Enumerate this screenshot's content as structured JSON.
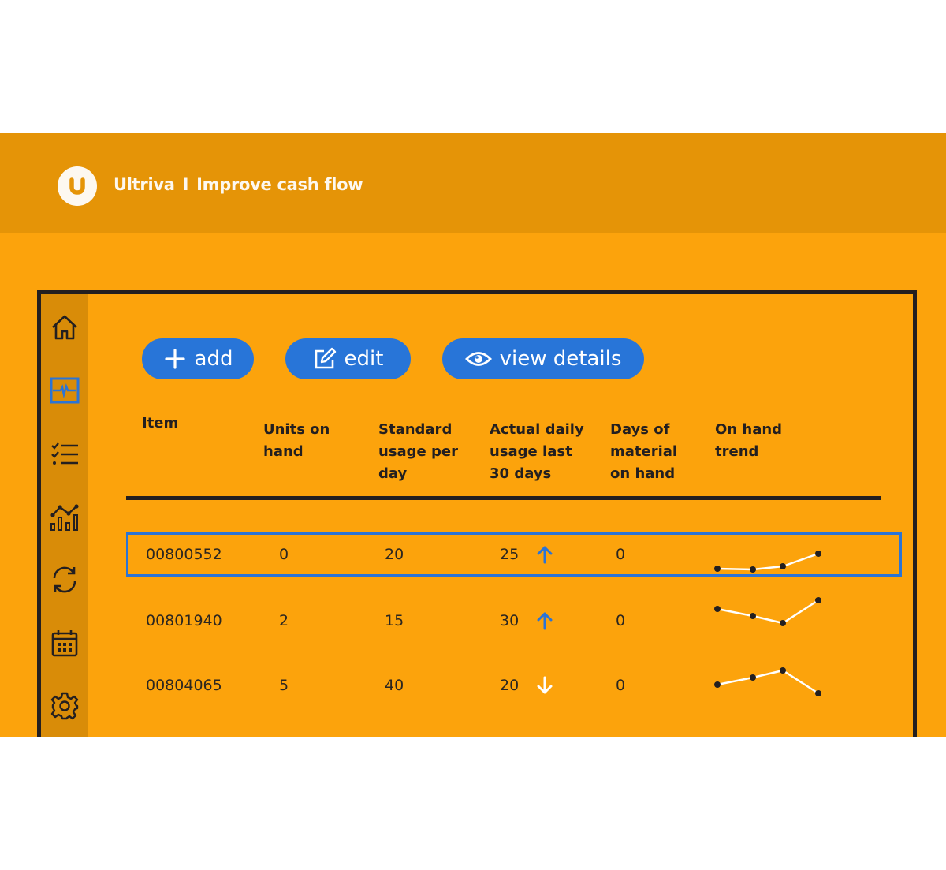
{
  "header": {
    "logo_letter": "U",
    "brand": "Ultriva",
    "separator": "I",
    "tagline": "Improve cash flow"
  },
  "sidebar": {
    "items": [
      {
        "name": "home",
        "icon": "home-icon",
        "active": false
      },
      {
        "name": "monitor",
        "icon": "pulse-monitor-icon",
        "active": true
      },
      {
        "name": "checklist",
        "icon": "checklist-icon",
        "active": false
      },
      {
        "name": "analytics",
        "icon": "analytics-chart-icon",
        "active": false
      },
      {
        "name": "refresh",
        "icon": "refresh-icon",
        "active": false
      },
      {
        "name": "calendar",
        "icon": "calendar-icon",
        "active": false
      },
      {
        "name": "settings",
        "icon": "gear-icon",
        "active": false
      }
    ]
  },
  "toolbar": {
    "add_label": "add",
    "edit_label": "edit",
    "view_label": "view details"
  },
  "table": {
    "columns": [
      "Item",
      "Units on hand",
      "Standard usage per day",
      "Actual daily usage last 30 days",
      "Days of material on hand",
      "On hand trend"
    ],
    "column_lines": [
      [
        "Item"
      ],
      [
        "Units on",
        "hand"
      ],
      [
        "Standard",
        "usage per",
        "day"
      ],
      [
        "Actual daily",
        "usage last",
        "30 days"
      ],
      [
        "Days of",
        "material",
        "on hand"
      ],
      [
        "On hand",
        "trend"
      ]
    ],
    "rows": [
      {
        "item": "00800552",
        "units_on_hand": "0",
        "standard_usage": "20",
        "actual_usage": "25",
        "direction": "up",
        "days_on_hand": "0",
        "trend": [
          1,
          0,
          4,
          20
        ],
        "selected": true
      },
      {
        "item": "00801940",
        "units_on_hand": "2",
        "standard_usage": "15",
        "actual_usage": "30",
        "direction": "up",
        "days_on_hand": "0",
        "trend": [
          18,
          9,
          0,
          29
        ],
        "selected": false
      },
      {
        "item": "00804065",
        "units_on_hand": "5",
        "standard_usage": "40",
        "actual_usage": "20",
        "direction": "down",
        "days_on_hand": "0",
        "trend": [
          11,
          20,
          29,
          0
        ],
        "selected": false
      }
    ]
  },
  "colors": {
    "background": "#fca30c",
    "header_band": "#e59407",
    "sidebar": "#d98c08",
    "accent_blue": "#2875d8",
    "up_arrow": "#2b74d6",
    "down_arrow": "#ffffff",
    "ink": "#231f20"
  }
}
